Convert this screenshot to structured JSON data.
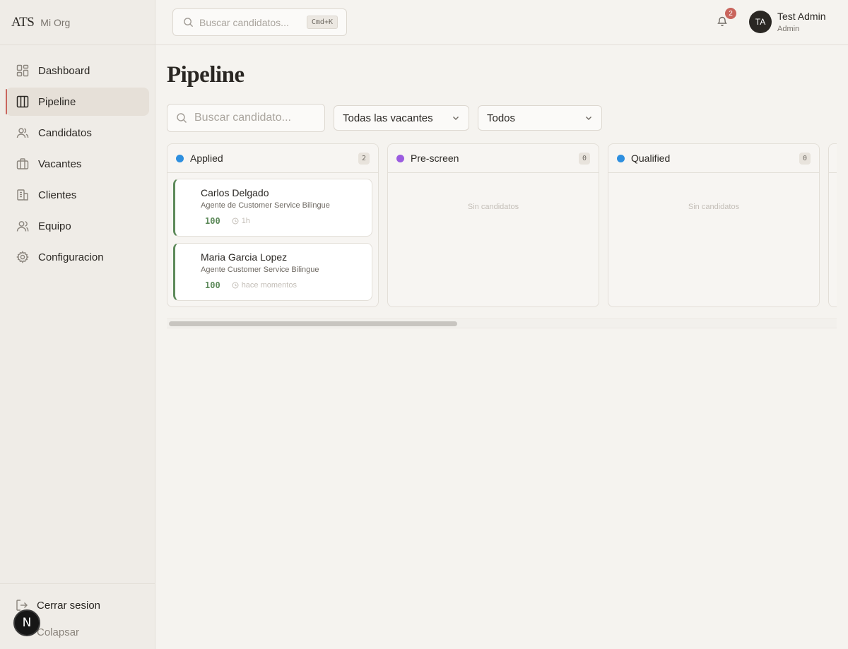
{
  "brand": {
    "logo": "ATS",
    "org": "Mi Org"
  },
  "sidebar": {
    "items": [
      {
        "label": "Dashboard",
        "icon": "dashboard-icon"
      },
      {
        "label": "Pipeline",
        "icon": "columns-icon",
        "active": true
      },
      {
        "label": "Candidatos",
        "icon": "users-icon"
      },
      {
        "label": "Vacantes",
        "icon": "briefcase-icon"
      },
      {
        "label": "Clientes",
        "icon": "building-icon"
      },
      {
        "label": "Equipo",
        "icon": "team-icon"
      },
      {
        "label": "Configuracion",
        "icon": "gear-icon"
      }
    ],
    "logout": "Cerrar sesion",
    "collapse": "Colapsar"
  },
  "topbar": {
    "search_placeholder": "Buscar candidatos...",
    "shortcut": "Cmd+K",
    "notifications": "2",
    "user": {
      "initials": "TA",
      "name": "Test Admin",
      "role": "Admin"
    }
  },
  "main": {
    "title": "Pipeline",
    "search_placeholder": "Buscar candidato...",
    "vacancy_filter": "Todas las vacantes",
    "status_filter": "Todos"
  },
  "colors": {
    "accent": "#c9655d",
    "applied": "#2e8fdf",
    "prescreen": "#9b5ce0",
    "qualified": "#2e8fdf",
    "score": "#5d8a5a"
  },
  "columns": [
    {
      "title": "Applied",
      "count": "2",
      "cards": [
        {
          "name": "Carlos Delgado",
          "role": "Agente de Customer Service Bilingue",
          "score": "100",
          "time": "1h"
        },
        {
          "name": "Maria Garcia Lopez",
          "role": "Agente Customer Service Bilingue",
          "score": "100",
          "time": "hace momentos"
        }
      ]
    },
    {
      "title": "Pre-screen",
      "count": "0",
      "empty": "Sin candidatos"
    },
    {
      "title": "Qualified",
      "count": "0",
      "empty": "Sin candidatos"
    }
  ],
  "bubble": "N"
}
